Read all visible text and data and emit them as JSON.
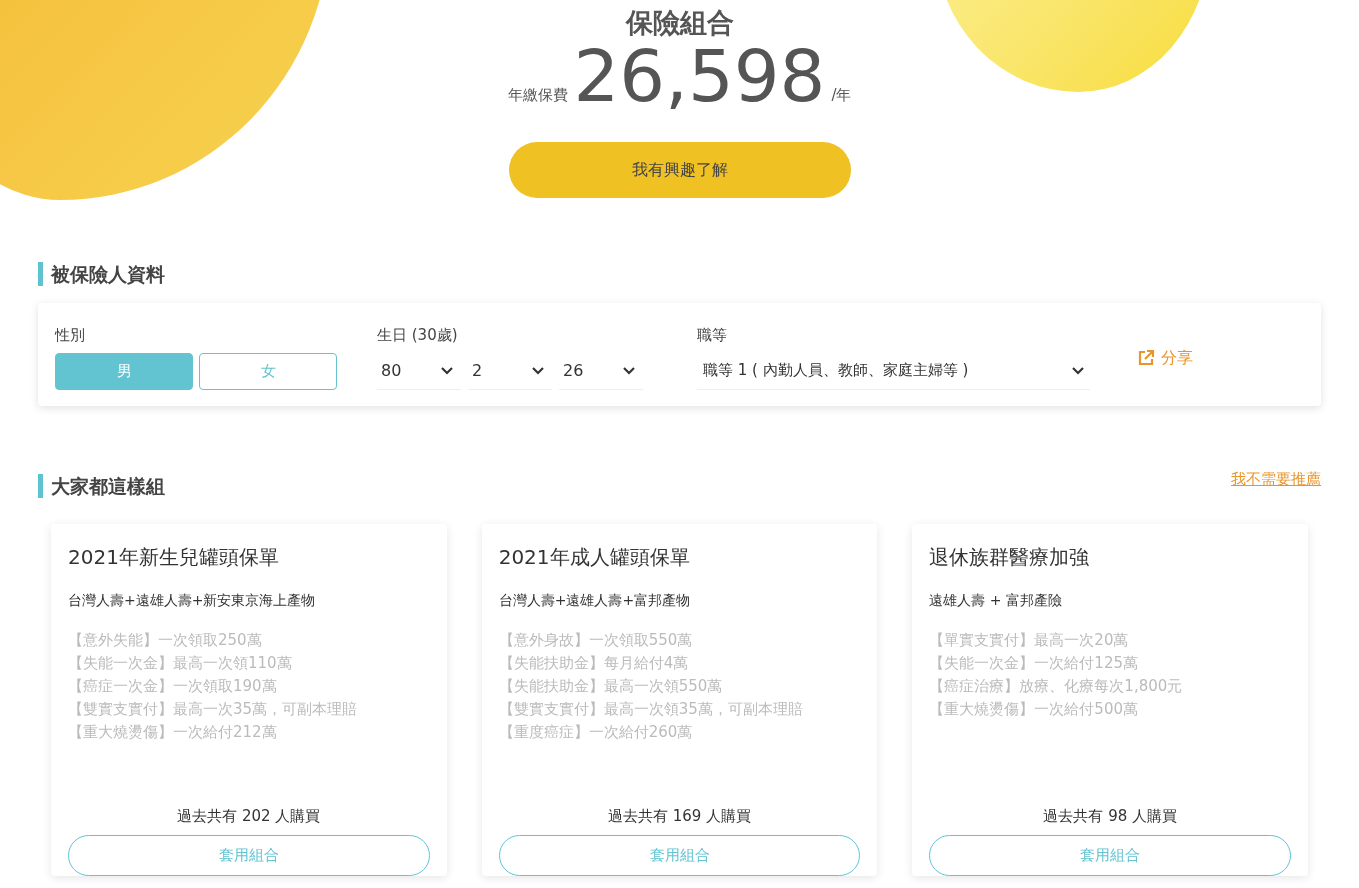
{
  "hero": {
    "title": "保險組合",
    "premium_label": "年繳保費",
    "premium": "26,598",
    "premium_unit": "/年",
    "cta": "我有興趣了解"
  },
  "insured": {
    "heading": "被保險人資料",
    "gender": {
      "label": "性別",
      "options": [
        {
          "label": "男",
          "selected": true
        },
        {
          "label": "女",
          "selected": false
        }
      ]
    },
    "birthday": {
      "label": "生日 (30歲)",
      "fields": [
        "80",
        "2",
        "26"
      ]
    },
    "occupation": {
      "label": "職等",
      "value": "職等 1 ( 內勤人員、教師、家庭主婦等 )"
    },
    "share": "分享"
  },
  "recommend": {
    "heading": "大家都這樣組",
    "skip_link": "我不需要推薦",
    "cards": [
      {
        "title": "2021年新生兒罐頭保單",
        "companies": "台灣人壽+遠雄人壽+新安東京海上產物",
        "benefits": [
          "【意外失能】一次領取250萬",
          "【失能一次金】最高一次領110萬",
          "【癌症一次金】一次領取190萬",
          "【雙實支實付】最高一次35萬，可副本理賠",
          "【重大燒燙傷】一次給付212萬"
        ],
        "buyers": "過去共有 202 人購買",
        "button": "套用組合"
      },
      {
        "title": "2021年成人罐頭保單",
        "companies": "台灣人壽+遠雄人壽+富邦產物",
        "benefits": [
          "【意外身故】一次領取550萬",
          "【失能扶助金】每月給付4萬",
          "【失能扶助金】最高一次領550萬",
          "【雙實支實付】最高一次領35萬，可副本理賠",
          "【重度癌症】一次給付260萬"
        ],
        "buyers": "過去共有 169 人購買",
        "button": "套用組合"
      },
      {
        "title": "退休族群醫療加強",
        "companies": "遠雄人壽 + 富邦產險",
        "benefits": [
          "【單實支實付】最高一次20萬",
          "【失能一次金】一次給付125萬",
          "【癌症治療】放療、化療每次1,800元",
          "【重大燒燙傷】一次給付500萬"
        ],
        "buyers": "過去共有 98 人購買",
        "button": "套用組合"
      }
    ]
  }
}
